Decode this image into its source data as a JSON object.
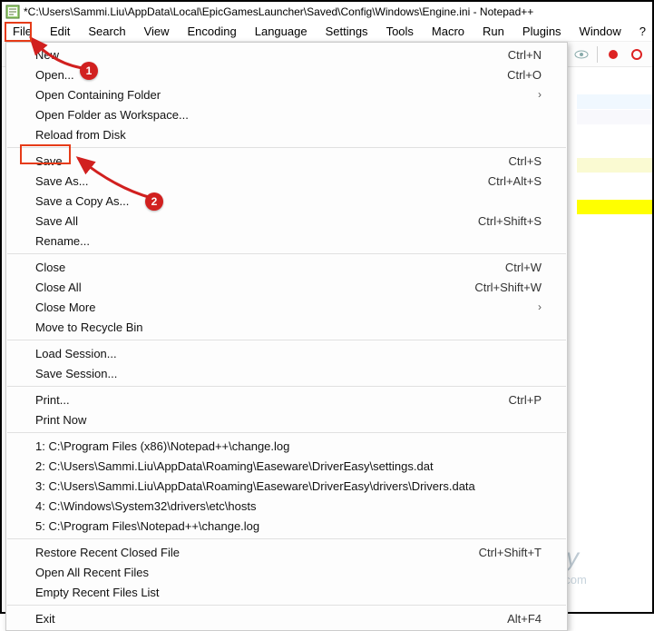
{
  "window": {
    "title": "*C:\\Users\\Sammi.Liu\\AppData\\Local\\EpicGamesLauncher\\Saved\\Config\\Windows\\Engine.ini - Notepad++"
  },
  "menubar": {
    "items": [
      "File",
      "Edit",
      "Search",
      "View",
      "Encoding",
      "Language",
      "Settings",
      "Tools",
      "Macro",
      "Run",
      "Plugins",
      "Window",
      "?"
    ]
  },
  "dropdown": {
    "new_label": "New",
    "new_sc": "Ctrl+N",
    "open_label": "Open...",
    "open_sc": "Ctrl+O",
    "open_folder_label": "Open Containing Folder",
    "open_ws_label": "Open Folder as Workspace...",
    "reload_label": "Reload from Disk",
    "save_label": "Save",
    "save_sc": "Ctrl+S",
    "saveas_label": "Save As...",
    "saveas_sc": "Ctrl+Alt+S",
    "savecopy_label": "Save a Copy As...",
    "saveall_label": "Save All",
    "saveall_sc": "Ctrl+Shift+S",
    "rename_label": "Rename...",
    "close_label": "Close",
    "close_sc": "Ctrl+W",
    "closeall_label": "Close All",
    "closeall_sc": "Ctrl+Shift+W",
    "closemore_label": "Close More",
    "recycle_label": "Move to Recycle Bin",
    "loadsess_label": "Load Session...",
    "savesess_label": "Save Session...",
    "print_label": "Print...",
    "print_sc": "Ctrl+P",
    "printnow_label": "Print Now",
    "recent1": "1: C:\\Program Files (x86)\\Notepad++\\change.log",
    "recent2": "2: C:\\Users\\Sammi.Liu\\AppData\\Roaming\\Easeware\\DriverEasy\\settings.dat",
    "recent3": "3: C:\\Users\\Sammi.Liu\\AppData\\Roaming\\Easeware\\DriverEasy\\drivers\\Drivers.data",
    "recent4": "4: C:\\Windows\\System32\\drivers\\etc\\hosts",
    "recent5": "5: C:\\Program Files\\Notepad++\\change.log",
    "restore_label": "Restore Recent Closed File",
    "restore_sc": "Ctrl+Shift+T",
    "openallrecent_label": "Open All Recent Files",
    "emptyrecent_label": "Empty Recent Files List",
    "exit_label": "Exit",
    "exit_sc": "Alt+F4"
  },
  "annotation": {
    "badge1": "1",
    "badge2": "2"
  },
  "watermark": {
    "brand": "driver easy",
    "url": "www.DriverEasy.com"
  }
}
